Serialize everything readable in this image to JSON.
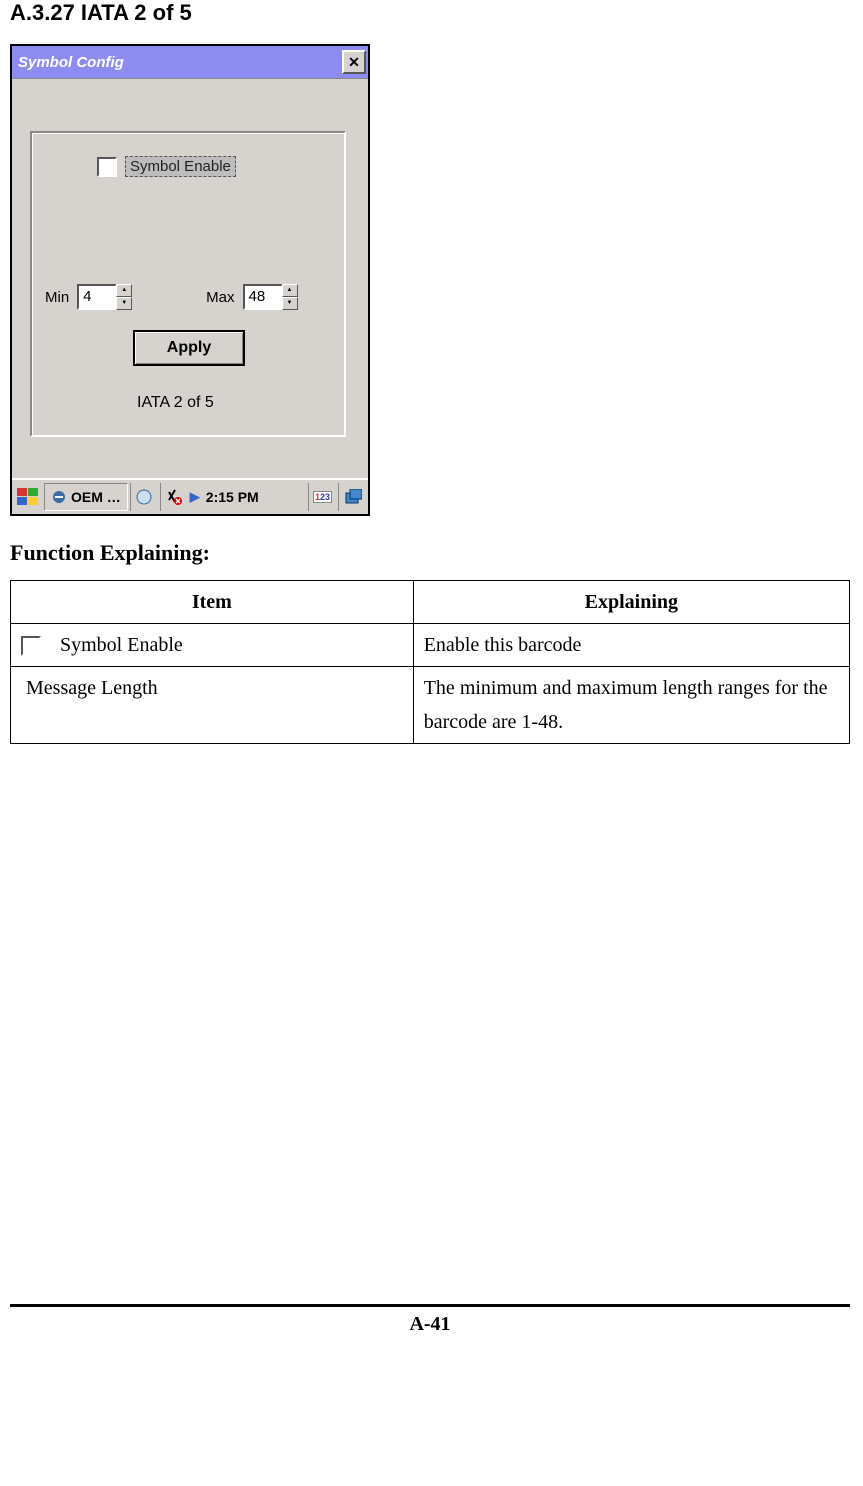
{
  "section_heading": "A.3.27 IATA 2 of 5",
  "dialog": {
    "title": "Symbol Config",
    "enable_label": "Symbol Enable",
    "min_label": "Min",
    "min_value": "4",
    "max_label": "Max",
    "max_value": "48",
    "apply_label": "Apply",
    "barcode_name": "IATA 2 of 5"
  },
  "taskbar": {
    "app_label": "OEM …",
    "time": "2:15 PM"
  },
  "function_heading": "Function Explaining:",
  "table": {
    "headers": [
      "Item",
      "Explaining"
    ],
    "rows": [
      {
        "item": "Symbol Enable",
        "has_checkbox": true,
        "explaining": "Enable this barcode"
      },
      {
        "item": "Message Length",
        "has_checkbox": false,
        "explaining": "The minimum and maximum length ranges for the barcode are 1-48."
      }
    ]
  },
  "page_number": "A-41"
}
